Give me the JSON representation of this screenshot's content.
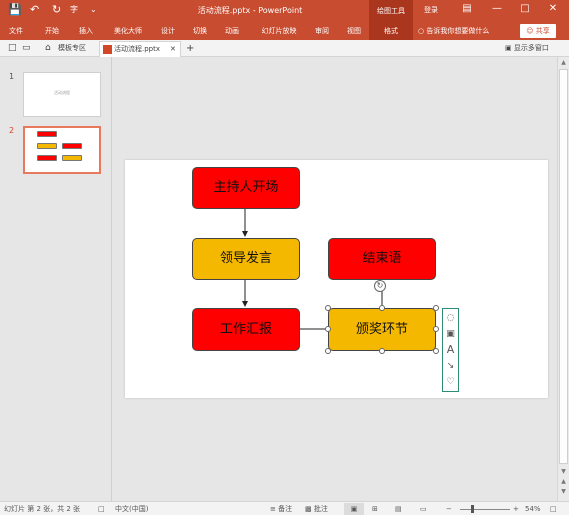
{
  "window": {
    "title": "活动流程.pptx - PowerPoint",
    "context_tools": "绘图工具",
    "login": "登录",
    "accent": "#c84c30"
  },
  "ribbon": {
    "tabs": [
      "文件",
      "开始",
      "插入",
      "美化大师",
      "设计",
      "切换",
      "动画",
      "幻灯片放映",
      "审阅",
      "视图",
      "格式"
    ],
    "active_tab": "格式",
    "tell_me": "告诉我你想要做什么",
    "share": "共享"
  },
  "doc_tabs": {
    "template_area": "模板专区",
    "file_tab": "活动流程.pptx",
    "multi_window": "显示多窗口"
  },
  "thumbnails": [
    {
      "number": "1",
      "caption": "活动流程"
    },
    {
      "number": "2",
      "caption": ""
    }
  ],
  "slide": {
    "boxes": [
      {
        "text": "主持人开场",
        "color": "#ff0000"
      },
      {
        "text": "领导发言",
        "color": "#f5b800"
      },
      {
        "text": "工作汇报",
        "color": "#ff0000"
      },
      {
        "text": "颁奖环节",
        "color": "#f5b800"
      },
      {
        "text": "结束语",
        "color": "#ff0000"
      }
    ]
  },
  "statusbar": {
    "slide_info": "幻灯片 第 2 张，共 2 张",
    "language": "中文(中国)",
    "notes": "备注",
    "comments": "批注",
    "zoom": "54%",
    "zoom_fraction": 0.54
  }
}
